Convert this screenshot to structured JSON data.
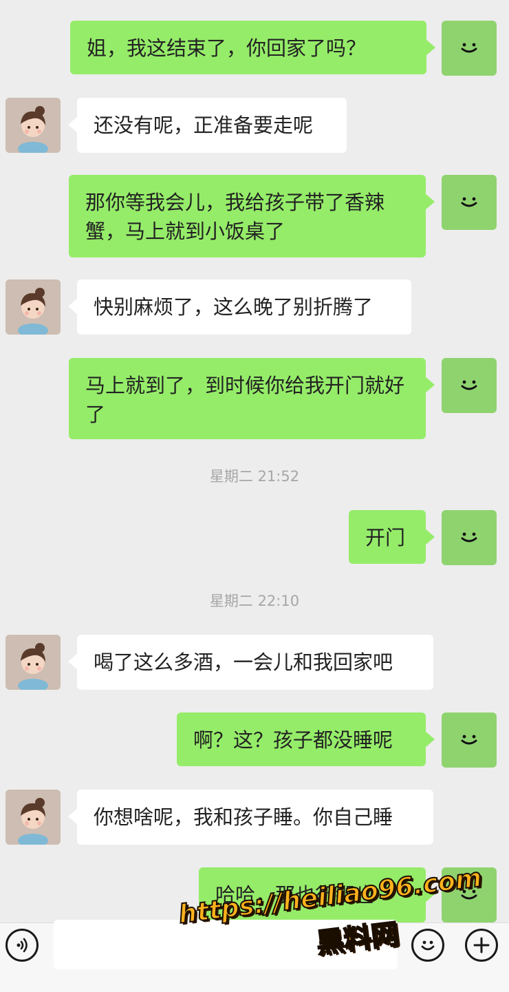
{
  "messages": [
    {
      "side": "me",
      "text": "姐，我这结束了，你回家了吗？"
    },
    {
      "side": "them",
      "text": "还没有呢，正准备要走呢"
    },
    {
      "side": "me",
      "text": "那你等我会儿，我给孩子带了香辣蟹，马上就到小饭桌了"
    },
    {
      "side": "them",
      "text": "快别麻烦了，这么晚了别折腾了"
    },
    {
      "side": "me",
      "text": "马上就到了，到时候你给我开门就好了"
    },
    {
      "side": "me",
      "text": "开门"
    },
    {
      "side": "them",
      "text": "喝了这么多酒，一会儿和我回家吧"
    },
    {
      "side": "me",
      "text": "啊？这？孩子都没睡呢"
    },
    {
      "side": "them",
      "text": "你想啥呢，我和孩子睡。你自己睡"
    },
    {
      "side": "me",
      "text": "哈哈，那也行那也"
    }
  ],
  "timestamps": [
    "星期二 21:52",
    "星期二 22:10"
  ],
  "input": {
    "placeholder": "",
    "value": ""
  },
  "icons": {
    "voice": "voice-icon",
    "emoji": "emoji-icon",
    "plus": "plus-icon",
    "self_avatar": "smile-avatar-icon"
  },
  "colors": {
    "background": "#ededed",
    "my_bubble": "#95ec69",
    "their_bubble": "#ffffff",
    "self_avatar": "#8fd36f",
    "watermark": "#ffb21c"
  },
  "watermark": {
    "url": "https://heiliao96.com",
    "name": "黑料网"
  }
}
